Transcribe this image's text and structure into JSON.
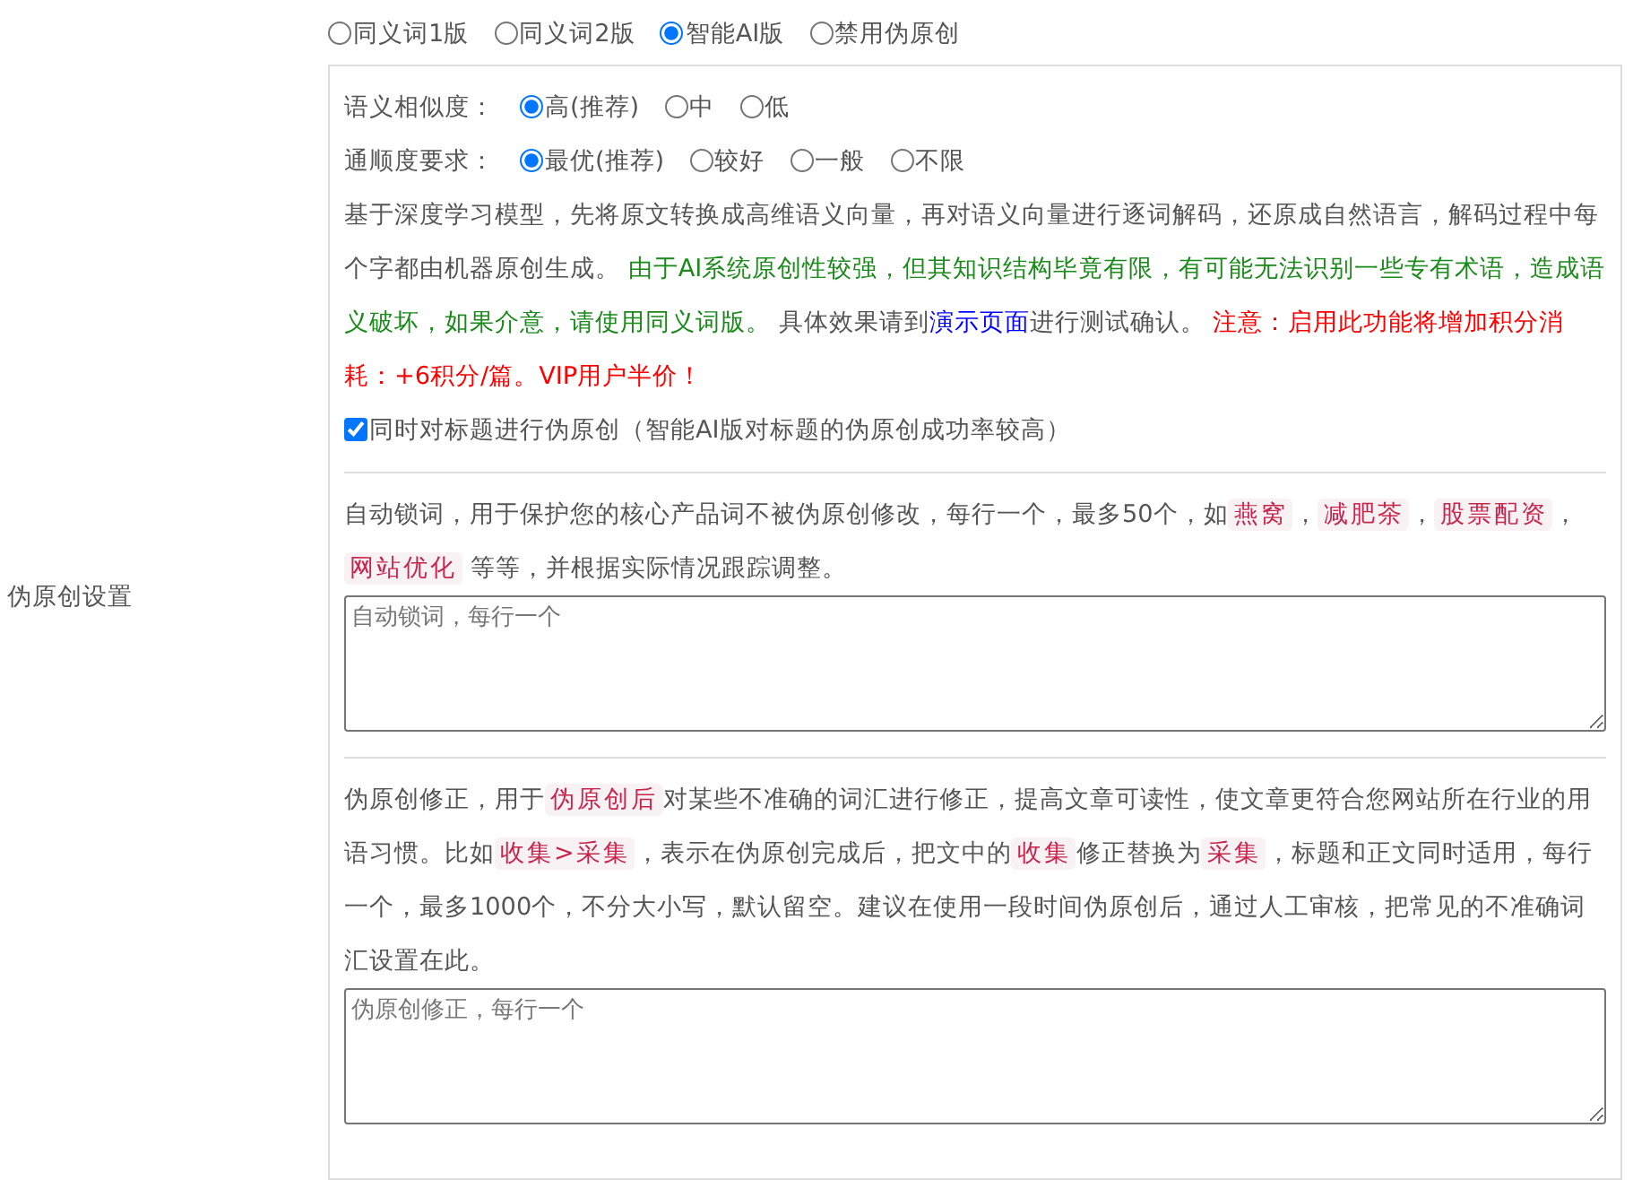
{
  "sidebar_label": "伪原创设置",
  "modes": [
    {
      "label": "同义词1版",
      "selected": false
    },
    {
      "label": "同义词2版",
      "selected": false
    },
    {
      "label": "智能AI版",
      "selected": true
    },
    {
      "label": "禁用伪原创",
      "selected": false
    }
  ],
  "similarity": {
    "label": "语义相似度：",
    "options": [
      {
        "label": "高(推荐)",
        "selected": true
      },
      {
        "label": "中",
        "selected": false
      },
      {
        "label": "低",
        "selected": false
      }
    ]
  },
  "fluency": {
    "label": "通顺度要求：",
    "options": [
      {
        "label": "最优(推荐)",
        "selected": true
      },
      {
        "label": "较好",
        "selected": false
      },
      {
        "label": "一般",
        "selected": false
      },
      {
        "label": "不限",
        "selected": false
      }
    ]
  },
  "ai_description": [
    {
      "kind": "plain",
      "text": "基于深度学习模型，先将原文转换成高维语义向量，再对语义向量进行逐词解码，还原成自然语言，解码过程中每个字都由机器原创生成。 "
    },
    {
      "kind": "green",
      "text": "由于AI系统原创性较强，但其知识结构毕竟有限，有可能无法识别一些专有术语，造成语义破坏，如果介意，请使用同义词版。"
    },
    {
      "kind": "plain",
      "text": " 具体效果请到"
    },
    {
      "kind": "link",
      "text": "演示页面"
    },
    {
      "kind": "plain",
      "text": "进行测试确认。 "
    },
    {
      "kind": "red",
      "text": "注意：启用此功能将增加积分消耗：+6积分/篇。VIP用户半价！"
    }
  ],
  "title_checkbox": {
    "label": "同时对标题进行伪原创（智能AI版对标题的伪原创成功率较高）",
    "checked": true
  },
  "lock_words": {
    "description": [
      {
        "kind": "plain",
        "text": "自动锁词，用于保护您的核心产品词不被伪原创修改，每行一个，最多50个，如"
      },
      {
        "kind": "tag",
        "text": "燕窝"
      },
      {
        "kind": "plain",
        "text": "，"
      },
      {
        "kind": "tag",
        "text": "减肥茶"
      },
      {
        "kind": "plain",
        "text": "，"
      },
      {
        "kind": "tag",
        "text": "股票配资"
      },
      {
        "kind": "plain",
        "text": "，"
      },
      {
        "kind": "tag",
        "text": "网站优化"
      },
      {
        "kind": "plain",
        "text": " 等等，并根据实际情况跟踪调整。"
      }
    ],
    "placeholder": "自动锁词，每行一个"
  },
  "corrections": {
    "description": [
      {
        "kind": "plain",
        "text": "伪原创修正，用于"
      },
      {
        "kind": "tag",
        "text": "伪原创后"
      },
      {
        "kind": "plain",
        "text": "对某些不准确的词汇进行修正，提高文章可读性，使文章更符合您网站所在行业的用语习惯。比如"
      },
      {
        "kind": "tag",
        "text": "收集>采集"
      },
      {
        "kind": "plain",
        "text": "，表示在伪原创完成后，把文中的"
      },
      {
        "kind": "tag",
        "text": "收集"
      },
      {
        "kind": "plain",
        "text": "修正替换为"
      },
      {
        "kind": "tag",
        "text": "采集"
      },
      {
        "kind": "plain",
        "text": "，标题和正文同时适用，每行一个，最多1000个，不分大小写，默认留空。建议在使用一段时间伪原创后，通过人工审核，把常见的不准确词汇设置在此。"
      }
    ],
    "placeholder": "伪原创修正，每行一个"
  }
}
